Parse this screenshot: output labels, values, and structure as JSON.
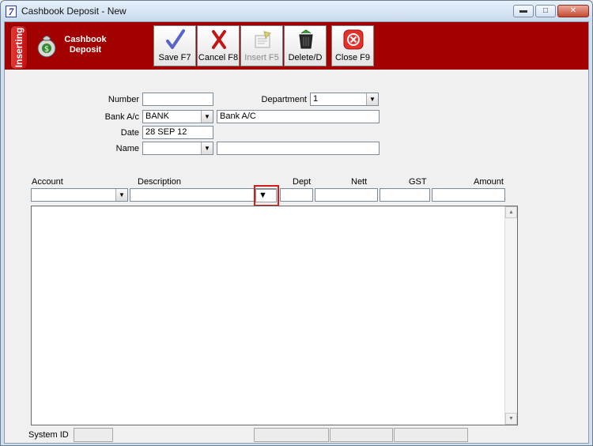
{
  "window": {
    "app_icon": "7",
    "title": "Cashbook Deposit - New",
    "buttons": {
      "minimize": "minimize-icon",
      "maximize": "maximize-icon",
      "close": "close-icon"
    }
  },
  "toolbar": {
    "mode": "Inserting",
    "form_title_line1": "Cashbook",
    "form_title_line2": "Deposit",
    "save": "Save F7",
    "cancel": "Cancel F8",
    "insert": "Insert F5",
    "delete": "Delete/D",
    "close": "Close F9"
  },
  "form": {
    "number_label": "Number",
    "number_value": "",
    "department_label": "Department",
    "department_value": "1",
    "bank_label": "Bank A/c",
    "bank_code": "BANK",
    "bank_name": "Bank A/C",
    "date_label": "Date",
    "date_value": "28 SEP 12",
    "name_label": "Name",
    "name_code": "",
    "name_value": ""
  },
  "grid": {
    "columns": [
      "Account",
      "Description",
      "Dept",
      "Nett",
      "GST",
      "Amount"
    ]
  },
  "status": {
    "system_id_label": "System ID",
    "system_id_value": ""
  },
  "colors": {
    "toolbar_bg": "#a30000",
    "highlight": "#d31b1b"
  }
}
